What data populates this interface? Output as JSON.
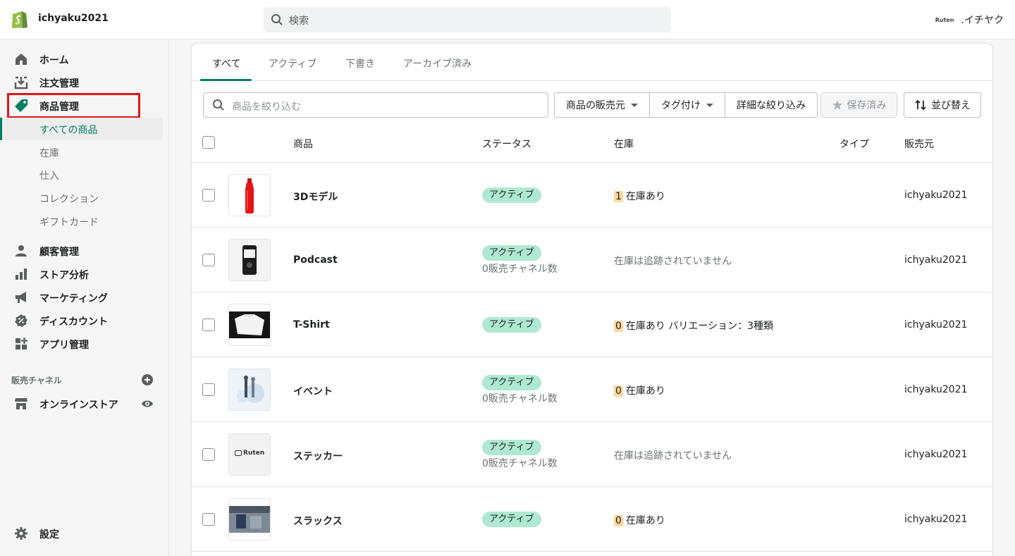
{
  "topbar": {
    "store_name": "ichyaku2021",
    "search_placeholder": "検索",
    "account_logo_text": "Ruten",
    "account_name": ".イチヤク"
  },
  "sidebar": {
    "items": [
      {
        "label": "ホーム",
        "icon": "home-icon"
      },
      {
        "label": "注文管理",
        "icon": "orders-icon"
      },
      {
        "label": "商品管理",
        "icon": "tag-icon"
      },
      {
        "label": "顧客管理",
        "icon": "person-icon"
      },
      {
        "label": "ストア分析",
        "icon": "analytics-icon"
      },
      {
        "label": "マーケティング",
        "icon": "megaphone-icon"
      },
      {
        "label": "ディスカウント",
        "icon": "discount-icon"
      },
      {
        "label": "アプリ管理",
        "icon": "apps-icon"
      }
    ],
    "sub_items": [
      {
        "label": "すべての商品",
        "active": true
      },
      {
        "label": "在庫"
      },
      {
        "label": "仕入"
      },
      {
        "label": "コレクション"
      },
      {
        "label": "ギフトカード"
      }
    ],
    "channels_title": "販売チャネル",
    "online_store": "オンラインストア",
    "settings": "設定"
  },
  "tabs": [
    {
      "label": "すべて",
      "active": true
    },
    {
      "label": "アクティブ"
    },
    {
      "label": "下書き"
    },
    {
      "label": "アーカイブ済み"
    }
  ],
  "filters": {
    "placeholder": "商品を絞り込む",
    "vendor_label": "商品の販売元",
    "tag_label": "タグ付け",
    "more_label": "詳細な絞り込み",
    "saved_label": "保存済み",
    "sort_label": "並び替え"
  },
  "table": {
    "headers": {
      "product": "商品",
      "status": "ステータス",
      "inventory": "在庫",
      "type": "タイプ",
      "vendor": "販売元"
    },
    "rows": [
      {
        "name": "3Dモデル",
        "status": "アクティブ",
        "channels": "",
        "inv_num": "1",
        "inv_text": "在庫あり",
        "vendor": "ichyaku2021",
        "thumb": "bottle"
      },
      {
        "name": "Podcast",
        "status": "アクティブ",
        "channels": "0販売チャネル数",
        "inv_num": "",
        "inv_text": "在庫は追跡されていません",
        "vendor": "ichyaku2021",
        "thumb": "phone"
      },
      {
        "name": "T-Shirt",
        "status": "アクティブ",
        "channels": "",
        "inv_num": "0",
        "inv_text": "在庫あり バリエーション：3種類",
        "vendor": "ichyaku2021",
        "thumb": "shirt"
      },
      {
        "name": "イベント",
        "status": "アクティブ",
        "channels": "0販売チャネル数",
        "inv_num": "0",
        "inv_text": "在庫あり",
        "vendor": "ichyaku2021",
        "thumb": "event"
      },
      {
        "name": "ステッカー",
        "status": "アクティブ",
        "channels": "0販売チャネル数",
        "inv_num": "",
        "inv_text": "在庫は追跡されていません",
        "vendor": "ichyaku2021",
        "thumb": "sticker"
      },
      {
        "name": "スラックス",
        "status": "アクティブ",
        "channels": "",
        "inv_num": "0",
        "inv_text": "在庫あり",
        "vendor": "ichyaku2021",
        "thumb": "slacks"
      }
    ],
    "sticker_thumb_text": "Ruten"
  },
  "colors": {
    "accent": "#008060",
    "badge": "#aee9d1",
    "highlight": "#e0161b",
    "inventory_num": "#ffd79d"
  }
}
